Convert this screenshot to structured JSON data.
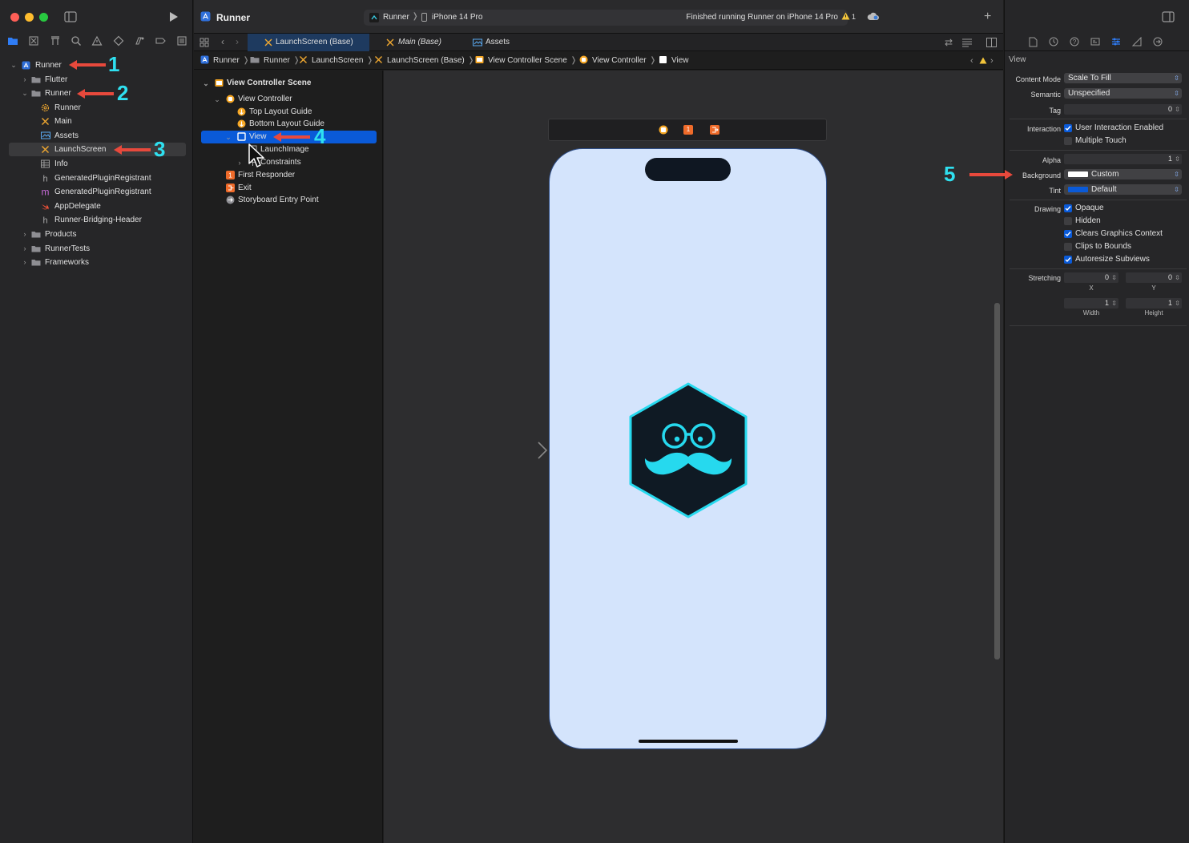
{
  "colors": {
    "accent": "#0a5ad8",
    "annotation_arrow": "#e8493c",
    "annotation_number": "#2fe0f0",
    "phone_bg": "#d4e4fc",
    "logo_cyan": "#26d9ee"
  },
  "toolbar": {
    "app_title": "Runner",
    "scheme": "Runner",
    "device": "iPhone 14 Pro",
    "status": "Finished running Runner on iPhone 14 Pro",
    "warning_count": "1"
  },
  "navigator": {
    "items": [
      {
        "label": "Runner",
        "icon": "project-icon"
      },
      {
        "label": "Flutter",
        "icon": "folder-icon"
      },
      {
        "label": "Runner",
        "icon": "folder-icon"
      },
      {
        "label": "Runner",
        "icon": "cog-icon"
      },
      {
        "label": "Main",
        "icon": "storyboard-icon"
      },
      {
        "label": "Assets",
        "icon": "assets-icon"
      },
      {
        "label": "LaunchScreen",
        "icon": "storyboard-icon"
      },
      {
        "label": "Info",
        "icon": "plist-icon"
      },
      {
        "label": "GeneratedPluginRegistrant",
        "icon": "header-icon"
      },
      {
        "label": "GeneratedPluginRegistrant",
        "icon": "objc-icon"
      },
      {
        "label": "AppDelegate",
        "icon": "swift-icon"
      },
      {
        "label": "Runner-Bridging-Header",
        "icon": "header-icon"
      },
      {
        "label": "Products",
        "icon": "folder-icon"
      },
      {
        "label": "RunnerTests",
        "icon": "folder-icon"
      },
      {
        "label": "Frameworks",
        "icon": "folder-icon"
      }
    ]
  },
  "tabs": [
    {
      "label": "LaunchScreen (Base)"
    },
    {
      "label": "Main (Base)"
    },
    {
      "label": "Assets"
    }
  ],
  "jumpbar": [
    "Runner",
    "Runner",
    "LaunchScreen",
    "LaunchScreen (Base)",
    "View Controller Scene",
    "View Controller",
    "View"
  ],
  "outline": {
    "items": [
      {
        "label": "View Controller Scene"
      },
      {
        "label": "View Controller"
      },
      {
        "label": "Top Layout Guide"
      },
      {
        "label": "Bottom Layout Guide"
      },
      {
        "label": "View"
      },
      {
        "label": "LaunchImage"
      },
      {
        "label": "Constraints"
      },
      {
        "label": "First Responder"
      },
      {
        "label": "Exit"
      },
      {
        "label": "Storyboard Entry Point"
      }
    ]
  },
  "scene_badge": "1",
  "inspector": {
    "section_title": "View",
    "content_mode_label": "Content Mode",
    "content_mode_value": "Scale To Fill",
    "semantic_label": "Semantic",
    "semantic_value": "Unspecified",
    "tag_label": "Tag",
    "tag_value": "0",
    "interaction_label": "Interaction",
    "user_interaction": "User Interaction Enabled",
    "multiple_touch": "Multiple Touch",
    "alpha_label": "Alpha",
    "alpha_value": "1",
    "background_label": "Background",
    "background_value": "Custom",
    "tint_label": "Tint",
    "tint_value": "Default",
    "drawing_label": "Drawing",
    "opaque": "Opaque",
    "hidden": "Hidden",
    "clears_graphics": "Clears Graphics Context",
    "clips_to_bounds": "Clips to Bounds",
    "autoresize": "Autoresize Subviews",
    "stretching_label": "Stretching",
    "stretch_x": "0",
    "stretch_y": "0",
    "x_label": "X",
    "y_label": "Y",
    "stretch_w": "1",
    "stretch_h": "1",
    "width_label": "Width",
    "height_label": "Height"
  },
  "annotations": [
    "1",
    "2",
    "3",
    "4",
    "5"
  ]
}
